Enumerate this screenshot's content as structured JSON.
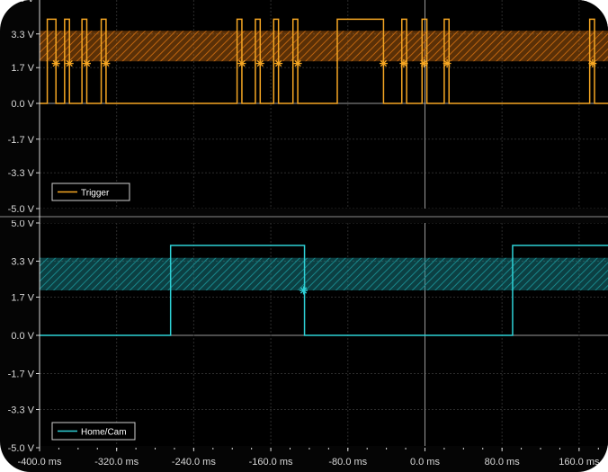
{
  "colors": {
    "background": "#050505",
    "plot_background": "#000000",
    "grid": "#2c2c2c",
    "grid_center": "#9a9a9a",
    "axis_text": "#d8d8d8",
    "divider": "#8a8a8a",
    "trigger_series": "#f5a623",
    "trigger_band": "#c86a10",
    "homecam_series": "#2ed1d6",
    "homecam_band": "#1a8f94",
    "legend_border": "#cfcfcf"
  },
  "chart_data": {
    "type": "line",
    "x_ticks": [
      "-400.0 ms",
      "-320.0 ms",
      "-240.0 ms",
      "-160.0 ms",
      "-80.0 ms",
      "0.0 ms",
      "80.0 ms",
      "160.0 ms"
    ],
    "x_tick_values": [
      -400,
      -320,
      -240,
      -160,
      -80,
      0,
      80,
      160
    ],
    "xlim": [
      -400,
      190
    ],
    "panels": [
      {
        "ylim": [
          -5.0,
          5.0
        ],
        "y_tick_labels": [
          "5.0 V",
          "3.3 V",
          "1.7 V",
          "0.0 V",
          "-1.7 V",
          "-3.3 V",
          "-5.0 V"
        ],
        "y_tick_values": [
          5.0,
          3.3,
          1.7,
          0.0,
          -1.7,
          -3.3,
          -5.0
        ],
        "legend": "Trigger",
        "band": [
          2.0,
          3.45
        ],
        "series": {
          "name": "Trigger",
          "low": 0.0,
          "high": 4.0,
          "pulses": [
            [
              -392,
              -383
            ],
            [
              -374,
              -369
            ],
            [
              -356,
              -351
            ],
            [
              -336,
              -331
            ],
            [
              -195,
              -190
            ],
            [
              -176,
              -171
            ],
            [
              -157,
              -152
            ],
            [
              -137,
              -132
            ],
            [
              -91,
              -43
            ],
            [
              -24,
              -19
            ],
            [
              -3,
              2
            ],
            [
              20,
              25
            ],
            [
              171,
              176
            ]
          ],
          "markers_at_volts": 1.9,
          "marker_x": [
            -383,
            -369,
            -351,
            -331,
            -190,
            -171,
            -152,
            -132,
            -43,
            -22,
            -1,
            23,
            174
          ]
        }
      },
      {
        "ylim": [
          -5.0,
          5.0
        ],
        "y_tick_labels": [
          "5.0 V",
          "3.3 V",
          "1.7 V",
          "0.0 V",
          "-1.7 V",
          "-3.3 V",
          "-5.0 V"
        ],
        "y_tick_values": [
          5.0,
          3.3,
          1.7,
          0.0,
          -1.7,
          -3.3,
          -5.0
        ],
        "legend": "Home/Cam",
        "band": [
          2.0,
          3.45
        ],
        "series": {
          "name": "Home/Cam",
          "low": 0.0,
          "high": 4.0,
          "pulses": [
            [
              -264,
              -125
            ],
            [
              91,
              200
            ]
          ],
          "markers_at_volts": 2.0,
          "marker_x": [
            -126
          ]
        }
      }
    ]
  }
}
